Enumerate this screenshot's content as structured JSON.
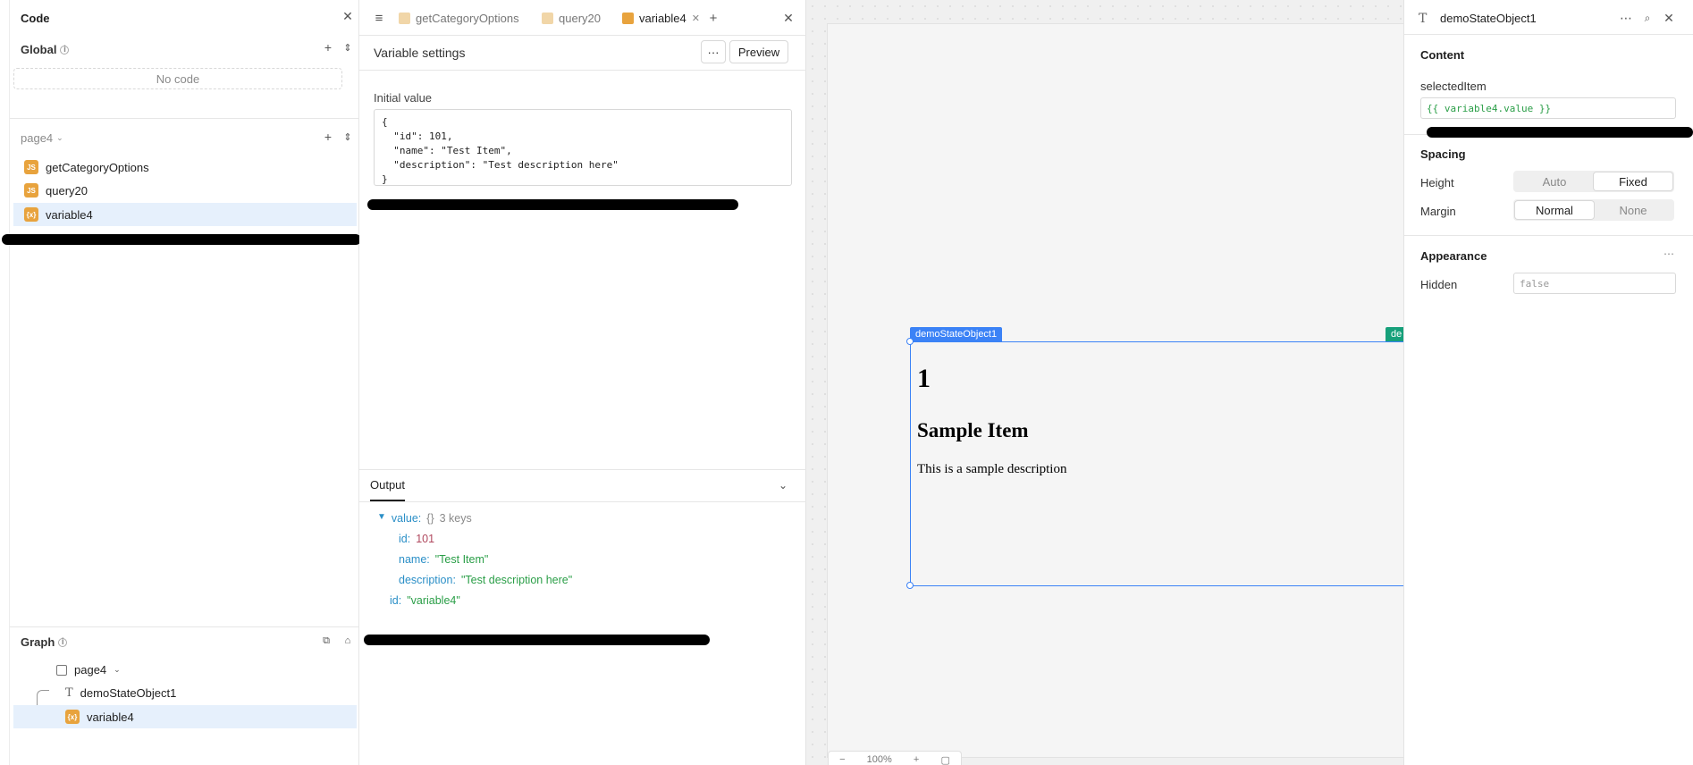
{
  "left_panel": {
    "title": "Code",
    "global": {
      "label": "Global",
      "empty_label": "No code"
    },
    "page": {
      "label": "page4",
      "items": [
        {
          "label": "getCategoryOptions",
          "icon": "js-icon"
        },
        {
          "label": "query20",
          "icon": "js-icon"
        },
        {
          "label": "variable4",
          "icon": "variable-icon"
        }
      ]
    },
    "graph": {
      "label": "Graph",
      "page": "page4",
      "nodes": [
        "demoStateObject1",
        "variable4"
      ]
    }
  },
  "editor": {
    "tabs": [
      {
        "label": "getCategoryOptions"
      },
      {
        "label": "query20"
      },
      {
        "label": "variable4"
      }
    ],
    "title": "Variable settings",
    "more_label": "···",
    "preview_label": "Preview",
    "initial_value_label": "Initial value",
    "initial_value": "{\n  \"id\": 101,\n  \"name\": \"Test Item\",\n  \"description\": \"Test description here\"\n}",
    "output": {
      "tab_label": "Output",
      "value_key": "value:",
      "value_type": "{}",
      "value_count": "3 keys",
      "rows": [
        {
          "key": "id:",
          "value": "101"
        },
        {
          "key": "name:",
          "value": "\"Test Item\""
        },
        {
          "key": "description:",
          "value": "\"Test description here\""
        }
      ],
      "id_key": "id:",
      "id_value": "\"variable4\""
    }
  },
  "canvas": {
    "component_tag": "demoStateObject1",
    "second_tag": "de",
    "heading": "1",
    "subheading": "Sample Item",
    "body": "This is a sample description",
    "zoom": "100%"
  },
  "inspector": {
    "title": "demoStateObject1",
    "content_label": "Content",
    "selected_item_label": "selectedItem",
    "selected_item_value": "{{ variable4.value }}",
    "spacing_label": "Spacing",
    "height_label": "Height",
    "height_options": [
      "Auto",
      "Fixed"
    ],
    "margin_label": "Margin",
    "margin_options": [
      "Normal",
      "None"
    ],
    "appearance_label": "Appearance",
    "hidden_label": "Hidden",
    "hidden_placeholder": "false"
  },
  "colors": {
    "accent": "#3b82f6",
    "js_badge": "#e8a33d",
    "string": "#2a9e47",
    "key": "#2b8fc7",
    "number": "#b0485e",
    "selected_row": "#e6f0fc"
  }
}
